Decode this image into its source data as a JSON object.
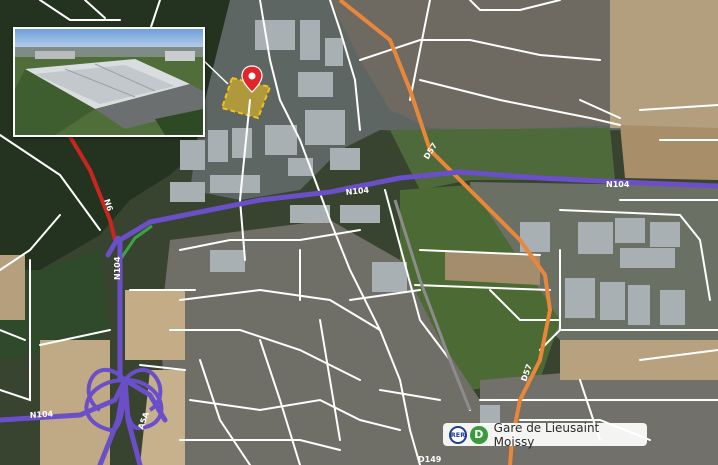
{
  "roads": {
    "n104_top": "N104",
    "n104_right": "N104",
    "n104_left": "N104",
    "d57_top": "D57",
    "d57_bottom": "D57",
    "n6": "N6",
    "n104_vertical": "N104",
    "a5a": "A5A",
    "d149": "D149"
  },
  "station": {
    "rer_badge": "RER",
    "line_badge": "D",
    "name": "Gare de Lieusaint Moissy"
  },
  "colors": {
    "highway": "#6a4fc8",
    "departmental": "#e8873a",
    "national": "#c8261e",
    "street": "#ffffff",
    "site_highlight": "#f2c21b",
    "marker": "#e0262b",
    "rer_blue": "#1d3f8f",
    "rer_d_green": "#3a9a3c"
  },
  "icons": {
    "location_marker": "map-pin-icon",
    "rer_logo": "rer-logo-icon",
    "line_d": "line-d-icon"
  }
}
